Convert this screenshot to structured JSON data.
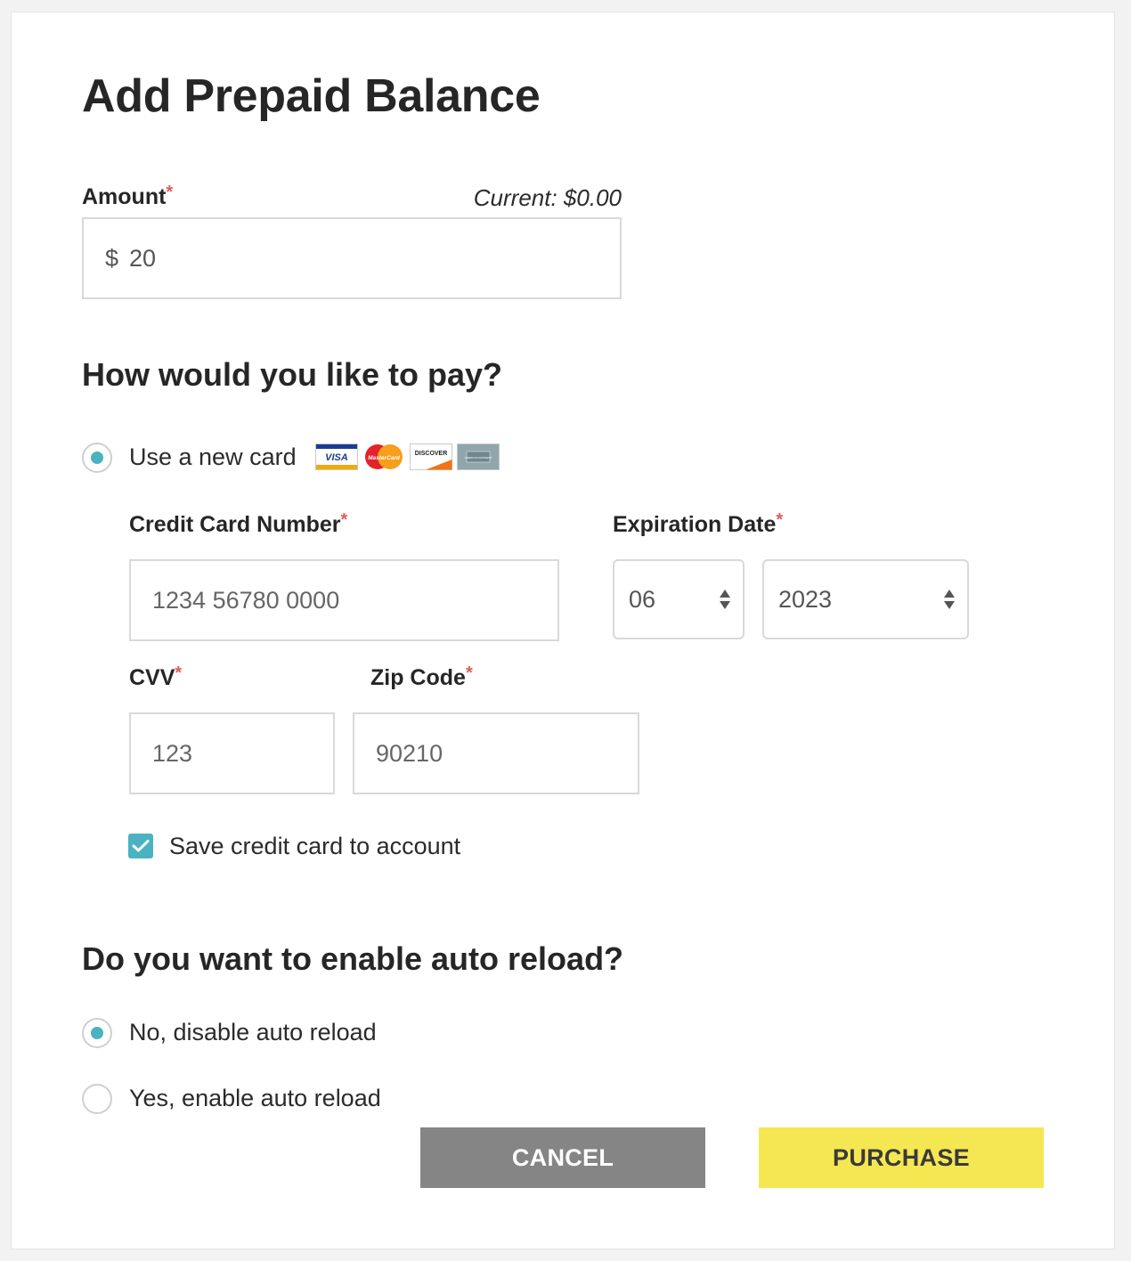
{
  "page": {
    "title": "Add Prepaid Balance"
  },
  "amount": {
    "label": "Amount",
    "required_mark": "*",
    "current": "Current: $0.00",
    "currency_symbol": "$",
    "value": "20"
  },
  "payment": {
    "heading": "How would you like to pay?",
    "new_card_option": "Use a new card",
    "new_card_selected": true,
    "card_brands": [
      "VISA",
      "MasterCard",
      "DISCOVER",
      "AMERICAN EXPRESS"
    ],
    "card_number": {
      "label": "Credit Card Number",
      "placeholder": "1234 56780 0000"
    },
    "expiration": {
      "label": "Expiration Date",
      "month": "06",
      "year": "2023"
    },
    "cvv": {
      "label": "CVV",
      "placeholder": "123"
    },
    "zip": {
      "label": "Zip Code",
      "placeholder": "90210"
    },
    "save_card": {
      "label": "Save credit card to account",
      "checked": true
    }
  },
  "auto_reload": {
    "heading": "Do you want to enable auto reload?",
    "options": [
      {
        "label": "No, disable auto reload",
        "selected": true
      },
      {
        "label": "Yes, enable auto reload",
        "selected": false
      }
    ]
  },
  "actions": {
    "cancel": "CANCEL",
    "purchase": "PURCHASE"
  },
  "colors": {
    "accent": "#4bb3c0",
    "purchase_bg": "#f5e752",
    "cancel_bg": "#858585",
    "required": "#e35a5a"
  }
}
